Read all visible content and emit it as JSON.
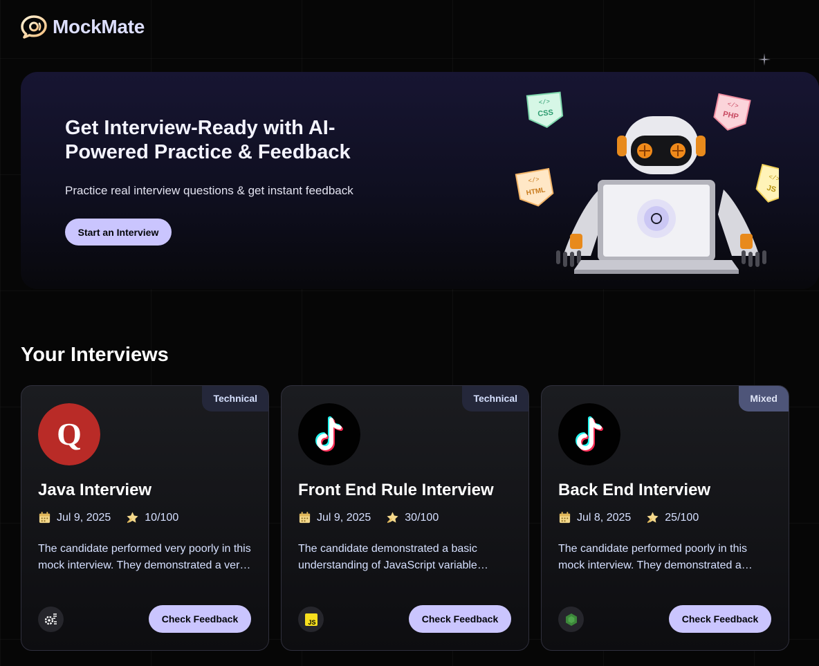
{
  "brand": {
    "name": "MockMate"
  },
  "hero": {
    "title": "Get Interview-Ready with AI-Powered Practice & Feedback",
    "subtitle": "Practice real interview questions & get instant feedback",
    "cta_label": "Start an Interview",
    "tags": [
      "CSS",
      "PHP",
      "HTML",
      "JS"
    ]
  },
  "section": {
    "title": "Your Interviews"
  },
  "interviews": [
    {
      "badge": "Technical",
      "avatar": "quora-logo",
      "title": "Java Interview",
      "date": "Jul 9, 2025",
      "score": "10/100",
      "description": "The candidate performed very poorly in this mock interview. They demonstrated a very limited understanding of Java fundamentals.",
      "tech_icon": "tech-stack-icon",
      "button_label": "Check Feedback"
    },
    {
      "badge": "Technical",
      "avatar": "tiktok-logo",
      "title": "Front End Rule Interview",
      "date": "Jul 9, 2025",
      "score": "30/100",
      "description": "The candidate demonstrated a basic understanding of JavaScript variable declarations but struggled with more advanced topics.",
      "tech_icon": "javascript-icon",
      "button_label": "Check Feedback"
    },
    {
      "badge": "Mixed",
      "avatar": "tiktok-logo",
      "title": "Back End Interview",
      "date": "Jul 8, 2025",
      "score": "25/100",
      "description": "The candidate performed poorly in this mock interview. They demonstrated a limited grasp of back end concepts.",
      "tech_icon": "nodejs-icon",
      "button_label": "Check Feedback"
    }
  ],
  "colors": {
    "accent": "#cac5fe",
    "background": "#060606",
    "badge_technical": "#24273a",
    "badge_mixed": "#4e5579",
    "meta_icon": "#f4d88b"
  }
}
